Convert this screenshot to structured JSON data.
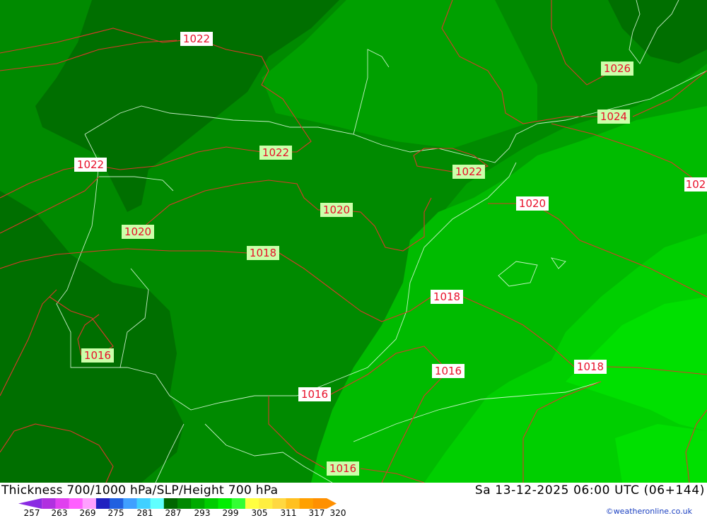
{
  "header": {
    "title": "Thickness 700/1000 hPa/SLP/Height 700 hPa",
    "datetime": "Sa 13-12-2025 06:00 UTC (06+144)"
  },
  "legend": {
    "ticks": [
      "257",
      "263",
      "269",
      "275",
      "281",
      "287",
      "293",
      "299",
      "305",
      "311",
      "317",
      "320"
    ],
    "colors": [
      "#8a2be2",
      "#b030e0",
      "#e040ef",
      "#ff60ff",
      "#ffa0ff",
      "#2020c0",
      "#2060e0",
      "#40a0ff",
      "#40d0ff",
      "#60ffff",
      "#006600",
      "#008800",
      "#00aa00",
      "#00cc00",
      "#00ee00",
      "#33ff33",
      "#ffff40",
      "#ffee40",
      "#ffd840",
      "#ffc020",
      "#ffa000",
      "#ff9000"
    ]
  },
  "credit": "©weatheronline.co.uk",
  "isobar_labels": [
    "1022",
    "1022",
    "1022",
    "1022",
    "1026",
    "1024",
    "102",
    "1020",
    "1020",
    "1020",
    "1018",
    "1018",
    "1018",
    "1016",
    "1016",
    "1016",
    "1016"
  ],
  "colors": {
    "darkest": "#006f00",
    "dark": "#008a00",
    "medium": "#00a000",
    "light": "#00bb00",
    "lighter": "#00cf00",
    "lightest": "#00e000",
    "isobar": "#d83a2a",
    "label_text": "#e8102a",
    "credit": "#1a3fc0"
  }
}
